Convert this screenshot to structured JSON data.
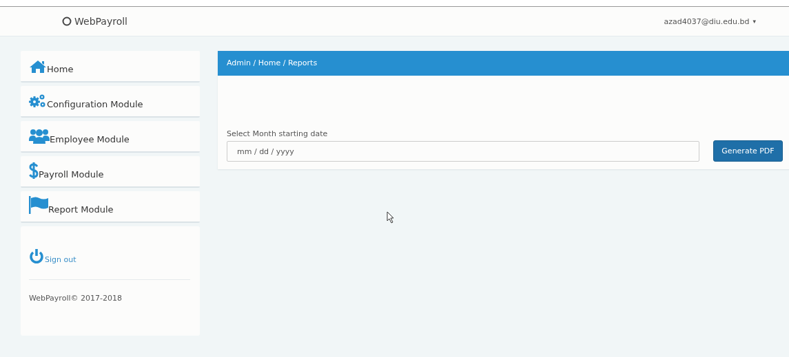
{
  "navbar": {
    "brand": "WebPayroll",
    "user": "azad4037@diu.edu.bd",
    "user_caret": "▾"
  },
  "sidebar": {
    "items": [
      {
        "label": "Home",
        "selected": false
      },
      {
        "label": "Configuration Module",
        "selected": false
      },
      {
        "label": "Employee Module",
        "selected": false
      },
      {
        "label": "Payroll Module",
        "selected": false
      },
      {
        "label": "Report Module",
        "selected": false
      }
    ],
    "sign_out": "Sign out",
    "footer": "WebPayroll© 2017-2018"
  },
  "panel": {
    "breadcrumb": "Admin / Home / Reports",
    "field_label": "Select Month starting date",
    "date_placeholder": "mm / dd / yyyy",
    "button": "Generate PDF"
  }
}
